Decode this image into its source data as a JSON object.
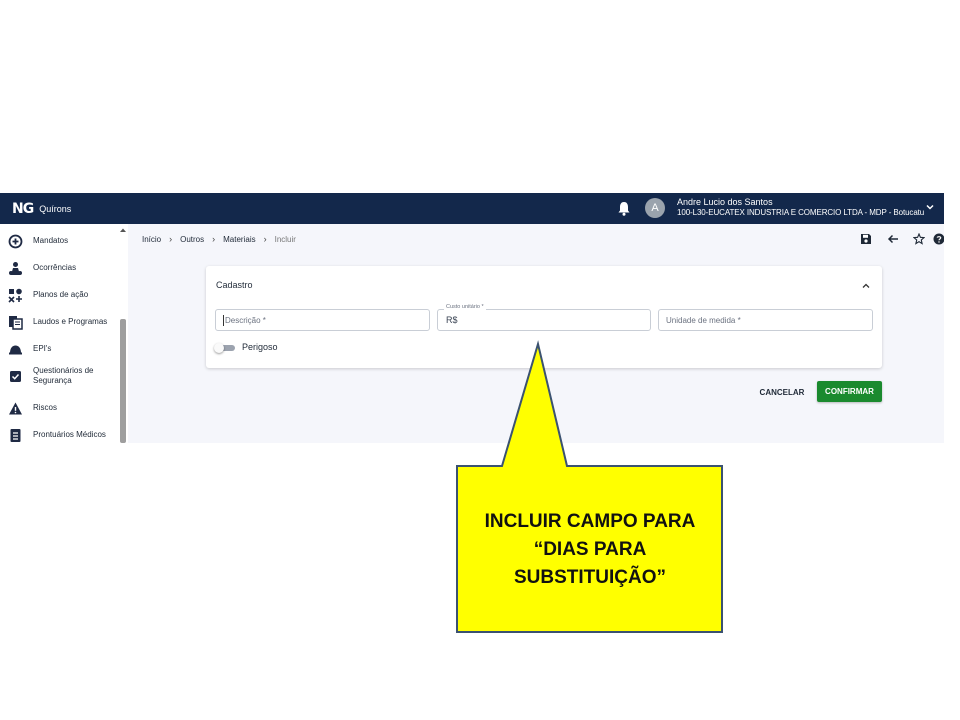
{
  "app": {
    "logo_mark": "NG",
    "logo_name": "Quírons",
    "user": {
      "avatar_letter": "A",
      "name": "Andre Lucio dos Santos",
      "company": "100-L30-EUCATEX INDUSTRIA E COMERCIO LTDA - MDP - Botucatu"
    }
  },
  "sidebar": {
    "items": [
      {
        "label": "Mandatos",
        "icon": "plus-circle-icon"
      },
      {
        "label": "Ocorrências",
        "icon": "people-alert-icon"
      },
      {
        "label": "Planos de ação",
        "icon": "action-plan-icon"
      },
      {
        "label": "Laudos e Programas",
        "icon": "documents-icon"
      },
      {
        "label": "EPI's",
        "icon": "helmet-icon"
      },
      {
        "label": "Questionários de Segurança",
        "icon": "checkbox-icon"
      },
      {
        "label": "Riscos",
        "icon": "warning-icon"
      },
      {
        "label": "Prontuários Médicos",
        "icon": "medical-record-icon"
      }
    ]
  },
  "breadcrumb": [
    "Início",
    "Outros",
    "Materiais",
    "Incluir"
  ],
  "form": {
    "section_title": "Cadastro",
    "descricao_placeholder": "Descrição *",
    "custo_label": "Custo unitário *",
    "custo_prefix": "R$",
    "unidade_placeholder": "Unidade de medida *",
    "perigoso_label": "Perigoso",
    "perigoso_on": false
  },
  "actions": {
    "cancel": "CANCELAR",
    "confirm": "CONFIRMAR"
  },
  "callout": {
    "lines": [
      "INCLUIR CAMPO PARA",
      "“DIAS PARA",
      "SUBSTITUIÇÃO”"
    ],
    "fill": "#ffff00",
    "border": "#3b5270"
  },
  "colors": {
    "topbar": "#13284b",
    "confirm": "#1a8a2e"
  }
}
